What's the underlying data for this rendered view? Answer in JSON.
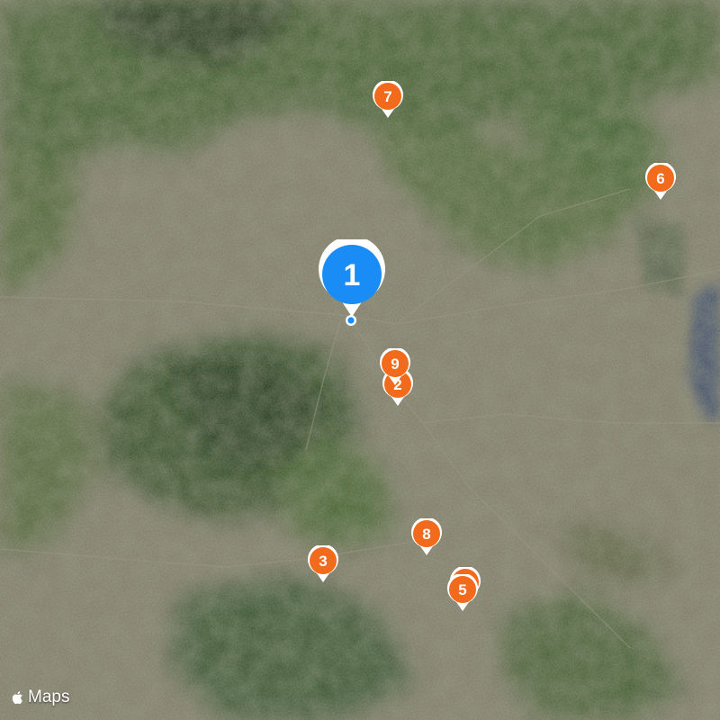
{
  "map": {
    "attribution": {
      "brand": "Maps",
      "logo_icon": "apple-logo-icon"
    },
    "colors": {
      "primary_pin": "#1a8cf5",
      "secondary_pin": "#f26a1b",
      "location_dot": "#1a8cf5"
    },
    "pins": [
      {
        "label": "1",
        "type": "primary"
      },
      {
        "label": "2",
        "type": "secondary"
      },
      {
        "label": "3",
        "type": "secondary"
      },
      {
        "label": "4",
        "type": "secondary"
      },
      {
        "label": "5",
        "type": "secondary"
      },
      {
        "label": "6",
        "type": "secondary"
      },
      {
        "label": "7",
        "type": "secondary"
      },
      {
        "label": "8",
        "type": "secondary"
      },
      {
        "label": "9",
        "type": "secondary"
      }
    ]
  }
}
